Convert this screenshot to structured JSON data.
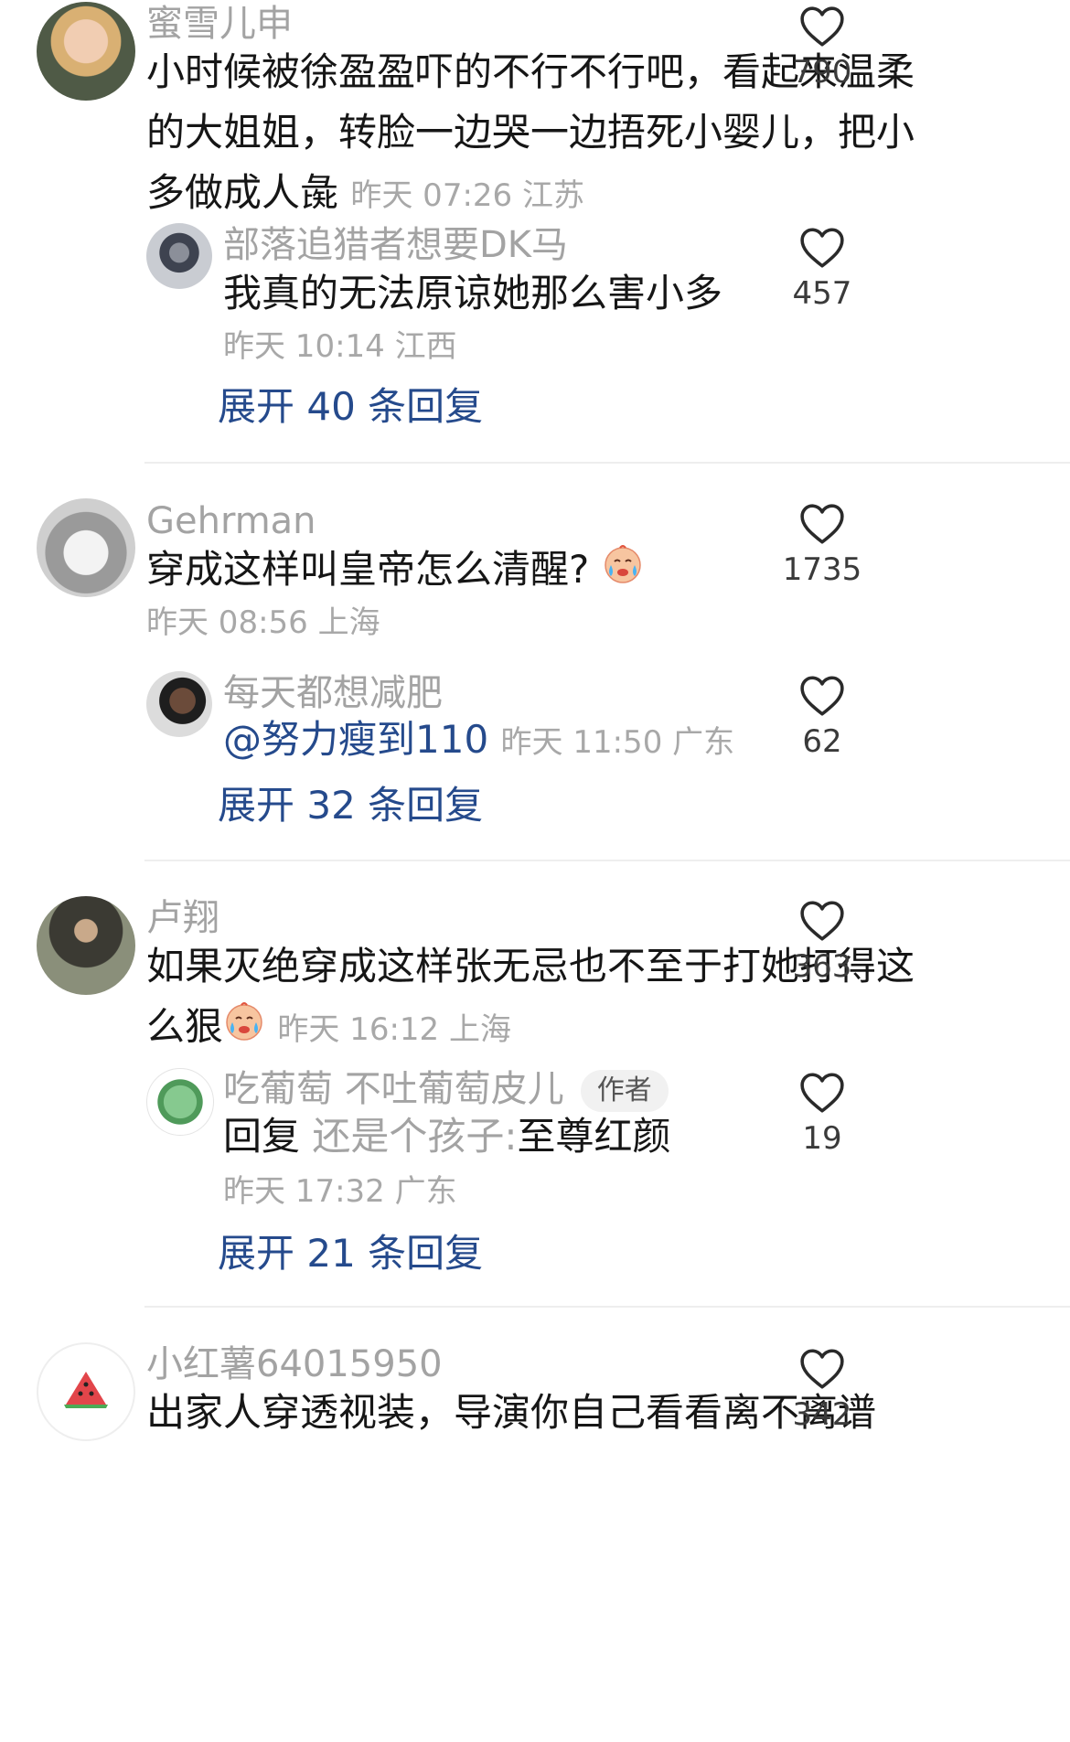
{
  "comments": [
    {
      "user": "蜜雪儿申",
      "text": "小时候被徐盈盈吓的不行不行吧，看起来温柔的大姐姐，转脸一边哭一边捂死小婴儿，把小多做成人彘",
      "meta": "昨天 07:26 江苏",
      "likes": "790",
      "reply": {
        "user": "部落追猎者想要DK马",
        "text": "我真的无法原谅她那么害小多",
        "meta": "昨天 10:14 江西",
        "likes": "457"
      },
      "expand": "展开 40 条回复"
    },
    {
      "user": "Gehrman",
      "text": "穿成这样叫皇帝怎么清醒?",
      "meta": "昨天 08:56 上海",
      "likes": "1735",
      "reply": {
        "user": "每天都想减肥",
        "mention": "@努力瘦到110",
        "meta": "昨天 11:50 广东",
        "likes": "62"
      },
      "expand": "展开 32 条回复"
    },
    {
      "user": "卢翔",
      "text": "如果灭绝穿成这样张无忌也不至于打她打得这么狠",
      "meta": "昨天 16:12 上海",
      "likes": "363",
      "reply": {
        "user": "吃葡萄 不吐葡萄皮儿",
        "tag": "作者",
        "reply_prefix": "回复",
        "reply_to": "还是个孩子:",
        "text": "至尊红颜",
        "meta": "昨天 17:32 广东",
        "likes": "19"
      },
      "expand": "展开 21 条回复"
    },
    {
      "user": "小红薯64015950",
      "text": "出家人穿透视装，导演你自己看看离不离谱",
      "likes": "342"
    }
  ],
  "icons": {
    "like": "heart-outline-icon",
    "emoji": "crying-face-emoji",
    "watermelon": "watermelon-icon"
  }
}
